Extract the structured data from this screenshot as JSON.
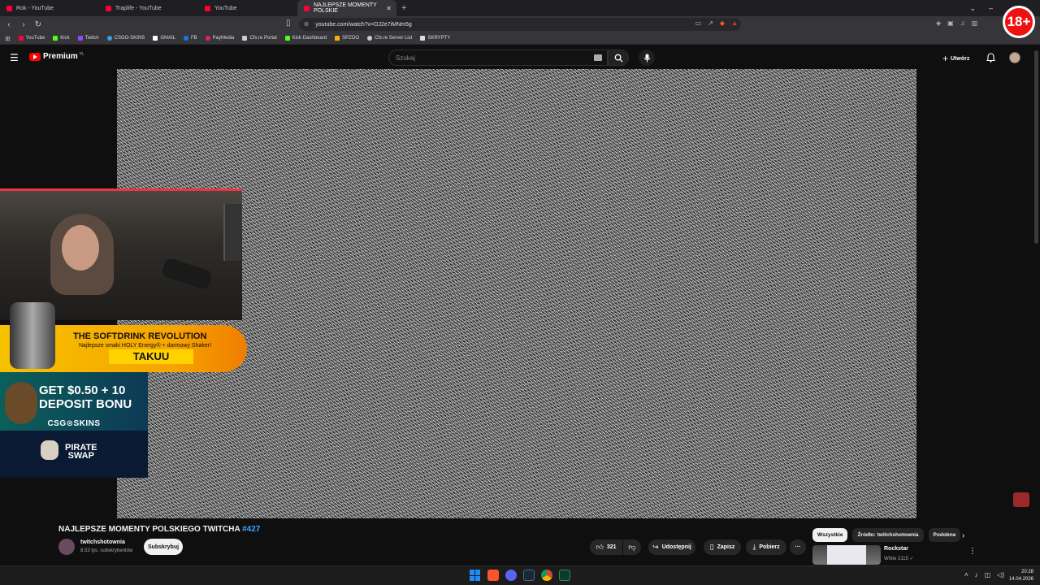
{
  "browser": {
    "tabs": [
      {
        "title": "Rok - YouTube",
        "active": false
      },
      {
        "title": "Traplife - YouTube",
        "active": false
      },
      {
        "title": "YouTube",
        "active": false
      },
      {
        "title": "NAJLEPSZE MOMENTY POLSKIE",
        "active": true
      }
    ],
    "new_tab_symbol": "+",
    "window_controls": [
      "⌄",
      "–",
      "☐",
      "✕"
    ],
    "url": "youtube.com/watch?v=OJ2e7iMNm5g",
    "bookmarks": [
      {
        "label": "YouTube",
        "color": "#ff0033"
      },
      {
        "label": "Kick",
        "color": "#53fc18"
      },
      {
        "label": "Twitch",
        "color": "#9146ff"
      },
      {
        "label": "CSGO-SKINS",
        "color": "#3a9ee4"
      },
      {
        "label": "GMAIL",
        "color": "#ffffff"
      },
      {
        "label": "FB",
        "color": "#1877f2"
      },
      {
        "label": "PayMedia",
        "color": "#e0245e"
      },
      {
        "label": "Cfx.re Portal",
        "color": "#cccccc"
      },
      {
        "label": "Kick Dashboard",
        "color": "#53fc18"
      },
      {
        "label": "SPZOO",
        "color": "#f5b400"
      },
      {
        "label": "Cfx.re Server List",
        "color": "#cccccc"
      },
      {
        "label": "SKRYPTY",
        "color": "#dddddd"
      }
    ]
  },
  "age_badge": "18+",
  "youtube": {
    "logo_text": "Premium",
    "logo_country": "PL",
    "search_placeholder": "Szukaj",
    "create_label": "Utwórz",
    "video": {
      "title": "NAJLEPSZE MOMENTY POLSKIEGO TWITCHA ",
      "title_tag": "#427",
      "channel": "twitchshotownia",
      "subscribers": "8,53 tys. subskrybentów",
      "subscribe_label": "Subskrybuj",
      "likes": "321",
      "share_label": "Udostępnij",
      "save_label": "Zapisz",
      "download_label": "Pobierz",
      "more_label": "···"
    },
    "chips": [
      {
        "label": "Wszystkie",
        "active": true
      },
      {
        "label": "Źródło: twitchshotownia",
        "active": false
      },
      {
        "label": "Podobne",
        "active": false
      }
    ],
    "recommendation": {
      "title": "Rockstar",
      "meta": "White 2115 ✓"
    }
  },
  "overlay": {
    "promo1_headline": "THE SOFTDRINK REVOLUTION",
    "promo1_sub": "Najlepsze smaki HOLY Energy® + darmowy Shaker!",
    "promo1_brand": "TAKUU",
    "promo2_line1": "GET $0.50 + 10",
    "promo2_line2": "DEPOSIT BONU",
    "promo2_brand": "CSG⊙SKINS",
    "promo3_line1": "PIRATE",
    "promo3_line2": "SWAP"
  },
  "taskbar": {
    "time": "20:28",
    "date": "14.04.2026"
  },
  "colors": {
    "youtube_red": "#ff0000",
    "link_blue": "#3ea6ff",
    "brave_orange": "#fb542b"
  }
}
